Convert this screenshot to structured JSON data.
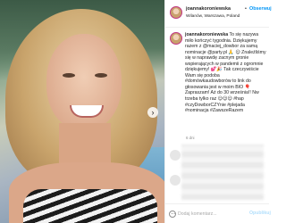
{
  "post": {
    "username": "joannakoroniewska",
    "follow_separator": "•",
    "follow_label": "Obserwuj",
    "location": "Wilanów, Warszawa, Poland",
    "caption_text": "To się nazywa miło kończyć tygodnia. Dziękujemy razem z @maciej_dowbor za samą nominacje @party.pl 🙏 😊 Znaleźliśmy się w naprawdę zacnym gronie wspierających w pandemii z ogromnie dziękujemy! 💕🎉 Tak czeczywiście Wam się podoba #domówkaudowborów to link do głosowania jest w moim BIO 🎈 Zapraszam! Aż do 30 września!! Nw trzeba tylko raz 😊😊😊 #hap #czyDowborCZYnie #plejada #nominacja #ZawszeRazem",
    "time_ago": "6 dni",
    "comment_placeholder": "Dodaj komentarz...",
    "post_label": "Opublikuj",
    "next_arrow": "›"
  },
  "icons": {
    "next": "chevron-right-icon",
    "emoji": "emoji-icon"
  },
  "colors": {
    "link_blue": "#0095f6",
    "text": "#262626",
    "muted": "#8e8e8e"
  }
}
